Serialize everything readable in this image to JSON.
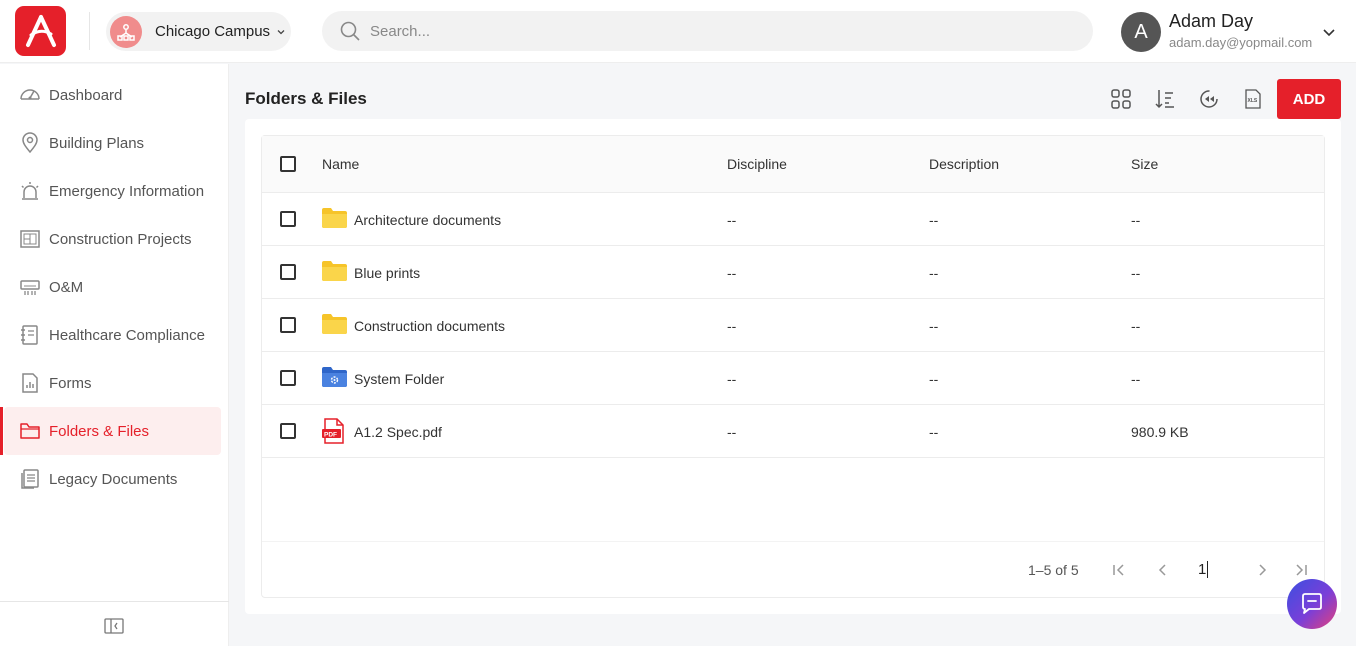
{
  "header": {
    "campus": "Chicago Campus",
    "search_placeholder": "Search...",
    "user": {
      "initial": "A",
      "name": "Adam Day",
      "email": "adam.day@yopmail.com"
    }
  },
  "sidebar": {
    "items": [
      {
        "label": "Dashboard",
        "icon": "gauge-icon"
      },
      {
        "label": "Building Plans",
        "icon": "map-pin-icon"
      },
      {
        "label": "Emergency Information",
        "icon": "alarm-icon"
      },
      {
        "label": "Construction Projects",
        "icon": "blueprint-icon"
      },
      {
        "label": "O&M",
        "icon": "hvac-icon"
      },
      {
        "label": "Healthcare Compliance",
        "icon": "notebook-icon"
      },
      {
        "label": "Forms",
        "icon": "form-icon"
      },
      {
        "label": "Folders & Files",
        "icon": "folder-icon",
        "active": true
      },
      {
        "label": "Legacy Documents",
        "icon": "documents-icon"
      }
    ]
  },
  "main": {
    "title": "Folders & Files",
    "add_label": "ADD",
    "columns": [
      "Name",
      "Discipline",
      "Description",
      "Size"
    ],
    "rows": [
      {
        "name": "Architecture documents",
        "type": "folder",
        "discipline": "--",
        "description": "--",
        "size": "--"
      },
      {
        "name": "Blue prints",
        "type": "folder",
        "discipline": "--",
        "description": "--",
        "size": "--"
      },
      {
        "name": "Construction documents",
        "type": "folder",
        "discipline": "--",
        "description": "--",
        "size": "--"
      },
      {
        "name": "System Folder",
        "type": "system-folder",
        "discipline": "--",
        "description": "--",
        "size": "--"
      },
      {
        "name": "A1.2 Spec.pdf",
        "type": "pdf",
        "discipline": "--",
        "description": "--",
        "size": "980.9 KB"
      }
    ],
    "pagination": {
      "info": "1–5 of 5",
      "page": "1"
    }
  },
  "colors": {
    "brand": "#e5202a",
    "folder": "#f9cf3a",
    "system_folder": "#3f7de0"
  }
}
